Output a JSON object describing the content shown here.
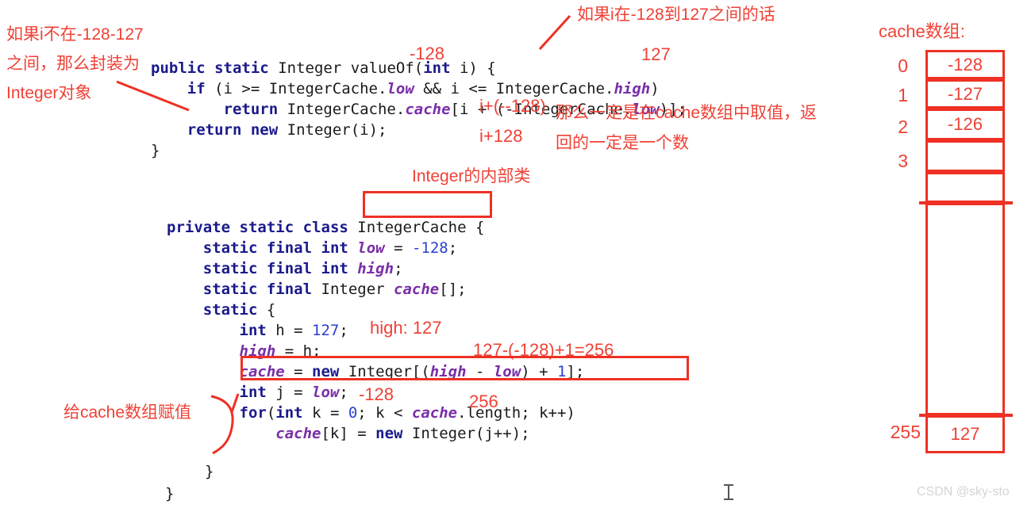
{
  "page": {
    "background": "#ffffff",
    "annotation_color": "#ef4136",
    "keyword_color": "#1a1a8c",
    "field_color": "#7a2fa8",
    "number_color": "#2b3fd0",
    "watermark": "CSDN @sky-sto"
  },
  "code_top": {
    "lines": [
      "public static Integer valueOf(int i) {",
      "    if (i >= IntegerCache.low && i <= IntegerCache.high)",
      "        return IntegerCache.cache[i + (-IntegerCache.low)];",
      "    return new Integer(i);",
      "}"
    ]
  },
  "code_bottom": {
    "lines": [
      "private static class IntegerCache {",
      "    static final int low = -128;",
      "    static final int high;",
      "    static final Integer cache[];",
      "    static {",
      "        int h = 127;",
      "        high = h;",
      "        cache = new Integer[(high - low) + 1];",
      "        int j = low;",
      "        for(int k = 0; k < cache.length; k++)",
      "            cache[k] = new Integer(j++);",
      "    }",
      "}"
    ]
  },
  "code_tokens": {
    "t_public": "public",
    "t_static": "static",
    "t_Integer": "Integer",
    "t_valueOf": " valueOf(",
    "t_int": "int",
    "t_i_paren": " i) {",
    "t_if": "if",
    "t_cond_a": " (i >= IntegerCache.",
    "t_low": "low",
    "t_cond_b": " && i <= IntegerCache.",
    "t_high": "high",
    "t_cond_c": ")",
    "t_return": "return",
    "t_ret_a": " IntegerCache.",
    "t_cache": "cache",
    "t_ret_b": "[i + (-IntegerCache.",
    "t_ret_c": ")];",
    "t_new": "new",
    "t_newint": " Integer(i);",
    "t_brace_close": "}",
    "t_private": "private",
    "t_class": "class",
    "t_IntegerCache": " IntegerCache {",
    "t_final": "final",
    "t_eq_128": " = ",
    "t_128": "-128",
    "t_semi": ";",
    "t_arr": "[];",
    "t_static_brace": " {",
    "t_h_eq": " h = ",
    "t_127": "127",
    "t_high_eq_h": " = h;",
    "t_cache_eq": " = ",
    "t_new_Integer_arr_a": " Integer[(",
    "t_minus": " - ",
    "t_plus1_a": ") + ",
    "t_1": "1",
    "t_bracket_semi": "];",
    "t_int_j": " j = ",
    "t_for": "for",
    "t_for_a": "(",
    "t_for_b": " k = ",
    "t_0": "0",
    "t_for_c": "; k < ",
    "t_for_d": ".length; k++)",
    "t_cachek": "cache",
    "t_cachek_a": "[k] = ",
    "t_cachek_b": " Integer(j++);"
  },
  "annotations": {
    "left_top": "如果i不在-128-127\n之间，那么封装为\nInteger对象",
    "top_right": "如果i在-128到127之间的话",
    "neg128_over_valueof": "-128",
    "p127_over_high": "127",
    "i_plus_neg128": "i+(--128)",
    "i_plus_128": "i+128",
    "cache_take_value": "那么一定是在cache数组中取值，返\n回的一定是一个数",
    "inner_class": "Integer的内部类",
    "high_127": "high: 127",
    "calc_256": "127-(-128)+1=256",
    "neg128_after_low": "-128",
    "len_256": "256",
    "assign_cache": "给cache数组赋值"
  },
  "cache_array": {
    "title": "cache数组:",
    "rows": [
      {
        "index": "0",
        "value": "-128"
      },
      {
        "index": "1",
        "value": "-127"
      },
      {
        "index": "2",
        "value": "-126"
      },
      {
        "index": "3",
        "value": ""
      },
      {
        "index": "",
        "value": ""
      },
      {
        "index": "",
        "value": ""
      },
      {
        "index": "255",
        "value": "127"
      }
    ]
  }
}
